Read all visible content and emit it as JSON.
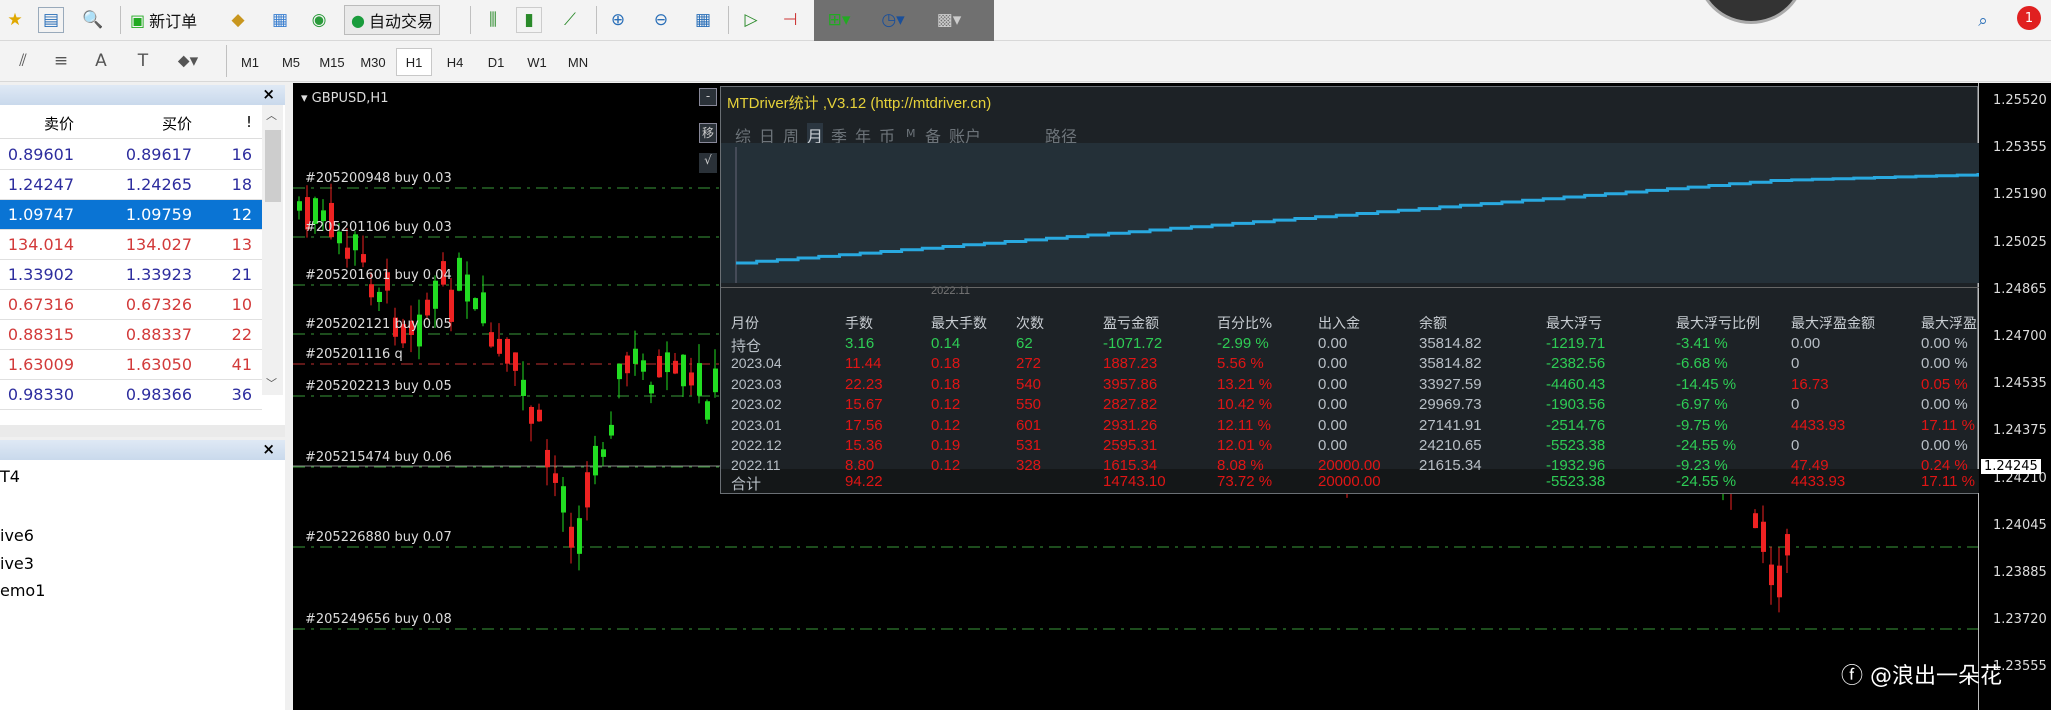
{
  "toolbar": {
    "new_order": "新订单",
    "auto_trade": "自动交易",
    "timeframes": [
      "M1",
      "M5",
      "M15",
      "M30",
      "H1",
      "H4",
      "D1",
      "W1",
      "MN"
    ],
    "active_timeframe": "H1",
    "notification_count": "1"
  },
  "market_watch": {
    "col_bid": "卖价",
    "col_ask": "买价",
    "col_spread": "!",
    "rows": [
      {
        "bid": "0.89601",
        "ask": "0.89617",
        "spread": "16",
        "color": "blue"
      },
      {
        "bid": "1.24247",
        "ask": "1.24265",
        "spread": "18",
        "color": "blue"
      },
      {
        "bid": "1.09747",
        "ask": "1.09759",
        "spread": "12",
        "color": "sel"
      },
      {
        "bid": "134.014",
        "ask": "134.027",
        "spread": "13",
        "color": "red"
      },
      {
        "bid": "1.33902",
        "ask": "1.33923",
        "spread": "21",
        "color": "blue"
      },
      {
        "bid": "0.67316",
        "ask": "0.67326",
        "spread": "10",
        "color": "red"
      },
      {
        "bid": "0.88315",
        "ask": "0.88337",
        "spread": "22",
        "color": "red"
      },
      {
        "bid": "1.63009",
        "ask": "1.63050",
        "spread": "41",
        "color": "red"
      },
      {
        "bid": "0.98330",
        "ask": "0.98366",
        "spread": "36",
        "color": "blue"
      }
    ]
  },
  "navigator": {
    "items": [
      "T4",
      "ive6",
      "ive3",
      "emo1"
    ]
  },
  "chart": {
    "symbol": "GBPUSD,H1",
    "orders": [
      "#205200948 buy 0.03",
      "#205201106 buy 0.03",
      "#205201601 buy 0.04",
      "#205202121 buy 0.05",
      "#205201116 q",
      "#205202213 buy 0.05",
      "#205215474 buy 0.06",
      "#205226880 buy 0.07",
      "#205249656 buy 0.08"
    ],
    "price_axis": [
      "1.25520",
      "1.25355",
      "1.25190",
      "1.25025",
      "1.24865",
      "1.24700",
      "1.24535",
      "1.24375",
      "1.24210",
      "1.24045",
      "1.23885",
      "1.23720",
      "1.23555"
    ],
    "current_price": "1.24245",
    "side_buttons": [
      "-",
      "移",
      "√"
    ]
  },
  "stats": {
    "title": "MTDriver统计 ,V3.12 (http://mtdriver.cn)",
    "tabs": [
      "综",
      "日",
      "周",
      "月",
      "季",
      "年",
      "币",
      "M",
      "备",
      "账户",
      "路径"
    ],
    "active_tab": "月",
    "graph_label": "2022.11",
    "headers": [
      "月份",
      "手数",
      "最大手数",
      "次数",
      "盈亏金额",
      "百分比%",
      "出入金",
      "余额",
      "最大浮亏",
      "最大浮亏比例",
      "最大浮盈金额",
      "最大浮盈"
    ],
    "rows": [
      [
        "持仓",
        "3.16",
        "0.14",
        "62",
        "-1071.72",
        "-2.99 %",
        "0.00",
        "35814.82",
        "-1219.71",
        "-3.41 %",
        "0.00",
        "0.00 %"
      ],
      [
        "2023.04",
        "11.44",
        "0.18",
        "272",
        "1887.23",
        "5.56 %",
        "0.00",
        "35814.82",
        "-2382.56",
        "-6.68 %",
        "0",
        "0.00 %"
      ],
      [
        "2023.03",
        "22.23",
        "0.18",
        "540",
        "3957.86",
        "13.21 %",
        "0.00",
        "33927.59",
        "-4460.43",
        "-14.45 %",
        "16.73",
        "0.05 %"
      ],
      [
        "2023.02",
        "15.67",
        "0.12",
        "550",
        "2827.82",
        "10.42 %",
        "0.00",
        "29969.73",
        "-1903.56",
        "-6.97 %",
        "0",
        "0.00 %"
      ],
      [
        "2023.01",
        "17.56",
        "0.12",
        "601",
        "2931.26",
        "12.11 %",
        "0.00",
        "27141.91",
        "-2514.76",
        "-9.75 %",
        "4433.93",
        "17.11 %"
      ],
      [
        "2022.12",
        "15.36",
        "0.19",
        "531",
        "2595.31",
        "12.01 %",
        "0.00",
        "24210.65",
        "-5523.38",
        "-24.55 %",
        "0",
        "0.00 %"
      ],
      [
        "2022.11",
        "8.80",
        "0.12",
        "328",
        "1615.34",
        "8.08 %",
        "20000.00",
        "21615.34",
        "-1932.96",
        "-9.23 %",
        "47.49",
        "0.24 %"
      ],
      [
        "合计",
        "94.22",
        "",
        "",
        "14743.10",
        "73.72 %",
        "20000.00",
        "",
        "-5523.38",
        "-24.55 %",
        "4433.93",
        "17.11 %"
      ]
    ]
  },
  "watermark": "@浪出一朵花",
  "colors": {
    "green": "#2ecc55",
    "red": "#e01515",
    "curve": "#29a9e0",
    "selected": "#0a74d4"
  }
}
